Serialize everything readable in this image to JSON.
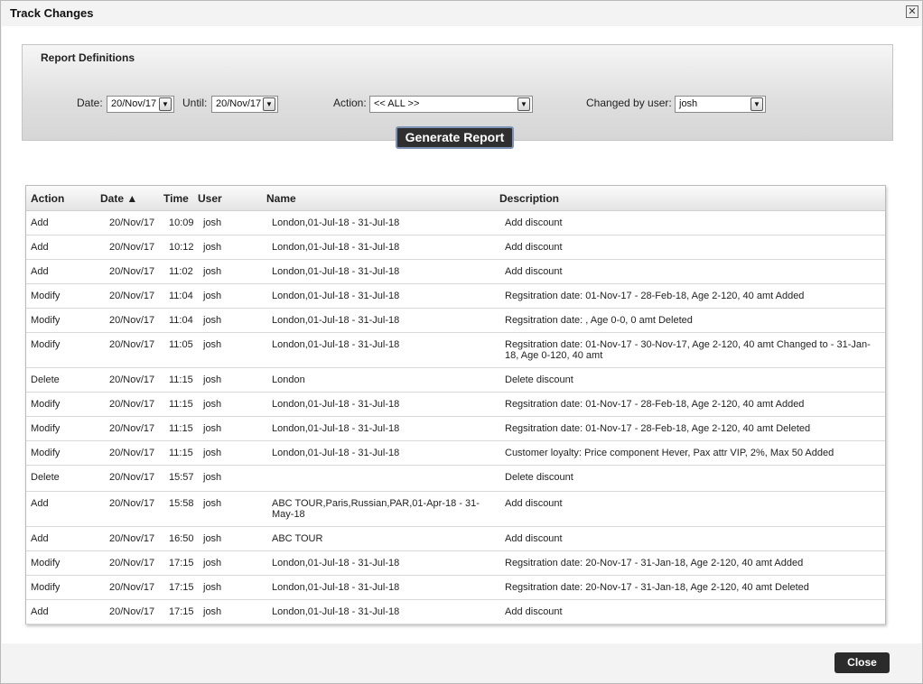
{
  "window": {
    "title": "Track Changes",
    "close_glyph": "✕"
  },
  "report_definitions": {
    "title": "Report Definitions",
    "date_label": "Date:",
    "date_value": "20/Nov/17",
    "until_label": "Until:",
    "until_value": "20/Nov/17",
    "action_label": "Action:",
    "action_value": "<< ALL >>",
    "user_label": "Changed by user:",
    "user_value": "josh",
    "generate_label": "Generate Report"
  },
  "table": {
    "columns": {
      "action": "Action",
      "date": "Date ▲",
      "time": "Time",
      "user": "User",
      "name": "Name",
      "description": "Description"
    },
    "rows": [
      {
        "action": "Add",
        "date": "20/Nov/17",
        "time": "10:09",
        "user": "josh",
        "name": "London,01-Jul-18 - 31-Jul-18",
        "description": "Add discount"
      },
      {
        "action": "Add",
        "date": "20/Nov/17",
        "time": "10:12",
        "user": "josh",
        "name": "London,01-Jul-18 - 31-Jul-18",
        "description": "Add discount"
      },
      {
        "action": "Add",
        "date": "20/Nov/17",
        "time": "11:02",
        "user": "josh",
        "name": "London,01-Jul-18 - 31-Jul-18",
        "description": "Add discount"
      },
      {
        "action": "Modify",
        "date": "20/Nov/17",
        "time": "11:04",
        "user": "josh",
        "name": "London,01-Jul-18 - 31-Jul-18",
        "description": "Regsitration date: 01-Nov-17 - 28-Feb-18, Age 2-120, 40 amt Added"
      },
      {
        "action": "Modify",
        "date": "20/Nov/17",
        "time": "11:04",
        "user": "josh",
        "name": "London,01-Jul-18 - 31-Jul-18",
        "description": "Regsitration date: , Age 0-0, 0 amt Deleted"
      },
      {
        "action": "Modify",
        "date": "20/Nov/17",
        "time": "11:05",
        "user": "josh",
        "name": "London,01-Jul-18 - 31-Jul-18",
        "description": "Regsitration date: 01-Nov-17 - 30-Nov-17, Age 2-120, 40 amt Changed to - 31-Jan-18, Age 0-120, 40 amt"
      },
      {
        "action": "Delete",
        "date": "20/Nov/17",
        "time": "11:15",
        "user": "josh",
        "name": "London",
        "description": "Delete discount"
      },
      {
        "action": "Modify",
        "date": "20/Nov/17",
        "time": "11:15",
        "user": "josh",
        "name": "London,01-Jul-18 - 31-Jul-18",
        "description": "Regsitration date: 01-Nov-17 - 28-Feb-18, Age 2-120, 40 amt Added"
      },
      {
        "action": "Modify",
        "date": "20/Nov/17",
        "time": "11:15",
        "user": "josh",
        "name": "London,01-Jul-18 - 31-Jul-18",
        "description": "Regsitration date: 01-Nov-17 - 28-Feb-18, Age 2-120, 40 amt Deleted"
      },
      {
        "action": "Modify",
        "date": "20/Nov/17",
        "time": "11:15",
        "user": "josh",
        "name": "London,01-Jul-18 - 31-Jul-18",
        "description": "Customer loyalty: Price component Hever, Pax attr VIP, 2%, Max 50 Added"
      },
      {
        "action": "Delete",
        "date": "20/Nov/17",
        "time": "15:57",
        "user": "josh",
        "name": "",
        "description": "Delete discount"
      },
      {
        "action": "Add",
        "date": "20/Nov/17",
        "time": "15:58",
        "user": "josh",
        "name": "ABC TOUR,Paris,Russian,PAR,01-Apr-18 - 31-May-18",
        "description": "Add discount"
      },
      {
        "action": "Add",
        "date": "20/Nov/17",
        "time": "16:50",
        "user": "josh",
        "name": "ABC TOUR",
        "description": "Add discount"
      },
      {
        "action": "Modify",
        "date": "20/Nov/17",
        "time": "17:15",
        "user": "josh",
        "name": "London,01-Jul-18 - 31-Jul-18",
        "description": "Regsitration date: 20-Nov-17 - 31-Jan-18, Age 2-120, 40 amt Added"
      },
      {
        "action": "Modify",
        "date": "20/Nov/17",
        "time": "17:15",
        "user": "josh",
        "name": "London,01-Jul-18 - 31-Jul-18",
        "description": "Regsitration date: 20-Nov-17 - 31-Jan-18, Age 2-120, 40 amt Deleted"
      },
      {
        "action": "Add",
        "date": "20/Nov/17",
        "time": "17:15",
        "user": "josh",
        "name": "London,01-Jul-18 - 31-Jul-18",
        "description": "Add discount"
      }
    ]
  },
  "footer": {
    "close_label": "Close"
  }
}
